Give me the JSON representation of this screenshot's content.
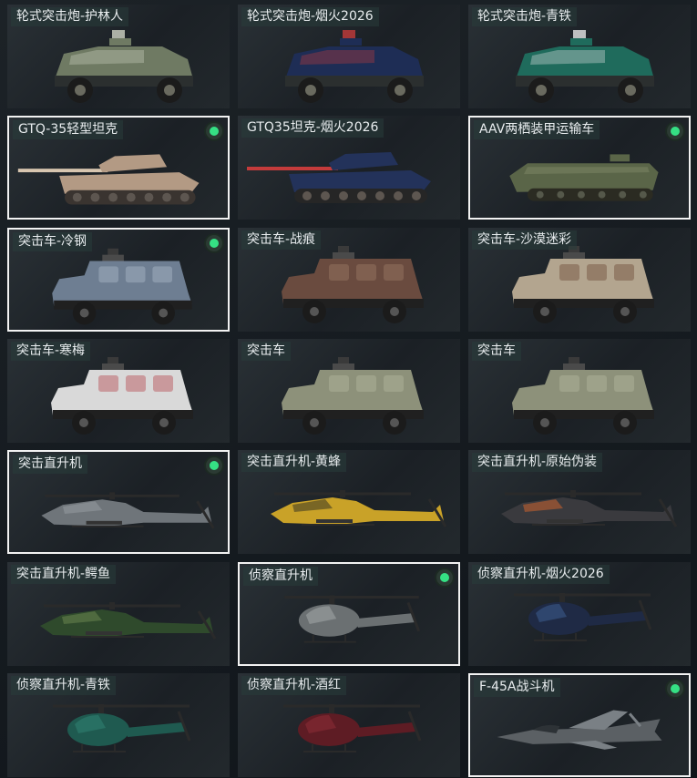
{
  "cards": [
    {
      "label": "轮式突击炮-护林人",
      "type": "armored-car",
      "colors": {
        "body": "#6f7a63",
        "accent": "#cfd3c4",
        "wheel": "#1b1b1b"
      },
      "selected": false,
      "owned": false
    },
    {
      "label": "轮式突击炮-烟火2026",
      "type": "armored-car",
      "colors": {
        "body": "#1e2d55",
        "accent": "#c43b3b",
        "wheel": "#1b1b1b"
      },
      "selected": false,
      "owned": false
    },
    {
      "label": "轮式突击炮-青铁",
      "type": "armored-car",
      "colors": {
        "body": "#1f6b5c",
        "accent": "#e6e6e6",
        "wheel": "#1b1b1b"
      },
      "selected": false,
      "owned": false
    },
    {
      "label": "GTQ-35轻型坦克",
      "type": "tank",
      "colors": {
        "body": "#b39a84",
        "accent": "#d8c6b0",
        "wheel": "#3a3430"
      },
      "selected": true,
      "owned": true
    },
    {
      "label": "GTQ35坦克-烟火2026",
      "type": "tank",
      "colors": {
        "body": "#23325a",
        "accent": "#c43b3b",
        "wheel": "#262626"
      },
      "selected": false,
      "owned": false
    },
    {
      "label": "AAV两栖装甲运输车",
      "type": "apc",
      "colors": {
        "body": "#5a6548",
        "accent": "#7d8766",
        "wheel": "#2b2b22"
      },
      "selected": true,
      "owned": true
    },
    {
      "label": "突击车-冷钢",
      "type": "truck",
      "colors": {
        "body": "#6e7e92",
        "accent": "#aab8c8",
        "wheel": "#1b1b1b"
      },
      "selected": true,
      "owned": true
    },
    {
      "label": "突击车-战痕",
      "type": "truck",
      "colors": {
        "body": "#6a4b3f",
        "accent": "#9b7a66",
        "wheel": "#1b1b1b"
      },
      "selected": false,
      "owned": false
    },
    {
      "label": "突击车-沙漠迷彩",
      "type": "truck",
      "colors": {
        "body": "#b3a58f",
        "accent": "#6e4e3a",
        "wheel": "#1b1b1b"
      },
      "selected": false,
      "owned": false
    },
    {
      "label": "突击车-寒梅",
      "type": "truck",
      "colors": {
        "body": "#d9d9d9",
        "accent": "#b54b52",
        "wheel": "#1b1b1b"
      },
      "selected": false,
      "owned": false
    },
    {
      "label": "突击车",
      "type": "truck",
      "colors": {
        "body": "#8d917a",
        "accent": "#b4b79e",
        "wheel": "#1b1b1b"
      },
      "selected": false,
      "owned": false
    },
    {
      "label": "突击车",
      "type": "truck",
      "colors": {
        "body": "#8d917a",
        "accent": "#b4b79e",
        "wheel": "#1b1b1b"
      },
      "selected": false,
      "owned": false
    },
    {
      "label": "突击直升机",
      "type": "attack-heli",
      "colors": {
        "body": "#6f757a",
        "accent": "#9aa0a4",
        "wheel": "#1b1b1b"
      },
      "selected": true,
      "owned": true
    },
    {
      "label": "突击直升机-黄蜂",
      "type": "attack-heli",
      "colors": {
        "body": "#c9a228",
        "accent": "#2a2a22",
        "wheel": "#1b1b1b"
      },
      "selected": false,
      "owned": false
    },
    {
      "label": "突击直升机-原始伪装",
      "type": "attack-heli",
      "colors": {
        "body": "#3a3a3e",
        "accent": "#d8652c",
        "wheel": "#1b1b1b"
      },
      "selected": false,
      "owned": false
    },
    {
      "label": "突击直升机-鳄鱼",
      "type": "attack-heli",
      "colors": {
        "body": "#2f4a2c",
        "accent": "#6f8a52",
        "wheel": "#1b1b1b"
      },
      "selected": false,
      "owned": false
    },
    {
      "label": "侦察直升机",
      "type": "scout-heli",
      "colors": {
        "body": "#6b7072",
        "accent": "#9ea3a5",
        "wheel": "#1b1b1b"
      },
      "selected": true,
      "owned": true
    },
    {
      "label": "侦察直升机-烟火2026",
      "type": "scout-heli",
      "colors": {
        "body": "#1f2a45",
        "accent": "#3b5a8a",
        "wheel": "#1b1b1b"
      },
      "selected": false,
      "owned": false
    },
    {
      "label": "侦察直升机-青铁",
      "type": "scout-heli",
      "colors": {
        "body": "#1f5a50",
        "accent": "#2e7f70",
        "wheel": "#1b1b1b"
      },
      "selected": false,
      "owned": false
    },
    {
      "label": "侦察直升机-酒红",
      "type": "scout-heli",
      "colors": {
        "body": "#5e1c24",
        "accent": "#8a2c36",
        "wheel": "#1b1b1b"
      },
      "selected": false,
      "owned": false
    },
    {
      "label": "F-45A战斗机",
      "type": "jet",
      "colors": {
        "body": "#5b6064",
        "accent": "#7a8085",
        "wheel": "#1b1b1b"
      },
      "selected": true,
      "owned": true
    }
  ]
}
